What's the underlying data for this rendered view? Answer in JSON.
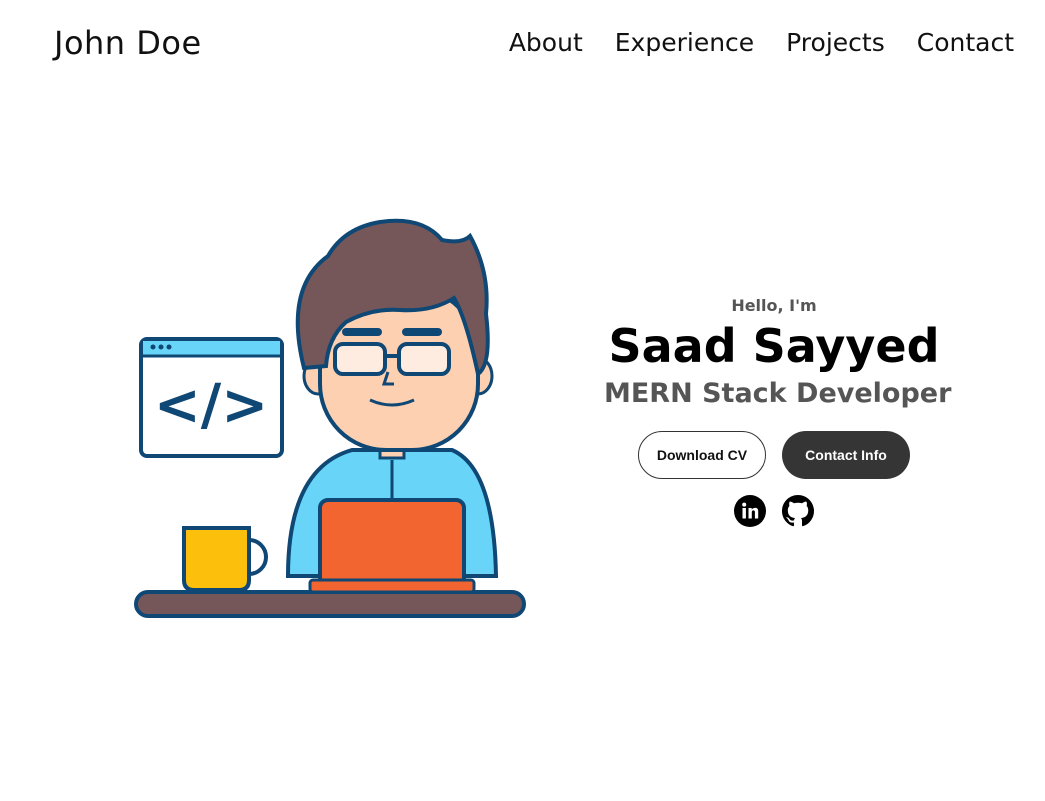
{
  "header": {
    "logo": "John Doe",
    "nav": [
      "About",
      "Experience",
      "Projects",
      "Contact"
    ]
  },
  "hero": {
    "greeting": "Hello, I'm",
    "name": "Saad Sayyed",
    "role": "MERN Stack Developer",
    "buttons": {
      "download_cv": "Download CV",
      "contact_info": "Contact Info"
    },
    "illustration_code_text": "</>",
    "socials": [
      "linkedin-icon",
      "github-icon"
    ]
  },
  "colors": {
    "text": "#000000",
    "muted": "#555555",
    "button_dark": "#353535",
    "hair": "#75575A",
    "shirt": "#67D4F8",
    "laptop": "#F26430",
    "mug": "#FBBF0C",
    "outline": "#0F4775"
  }
}
